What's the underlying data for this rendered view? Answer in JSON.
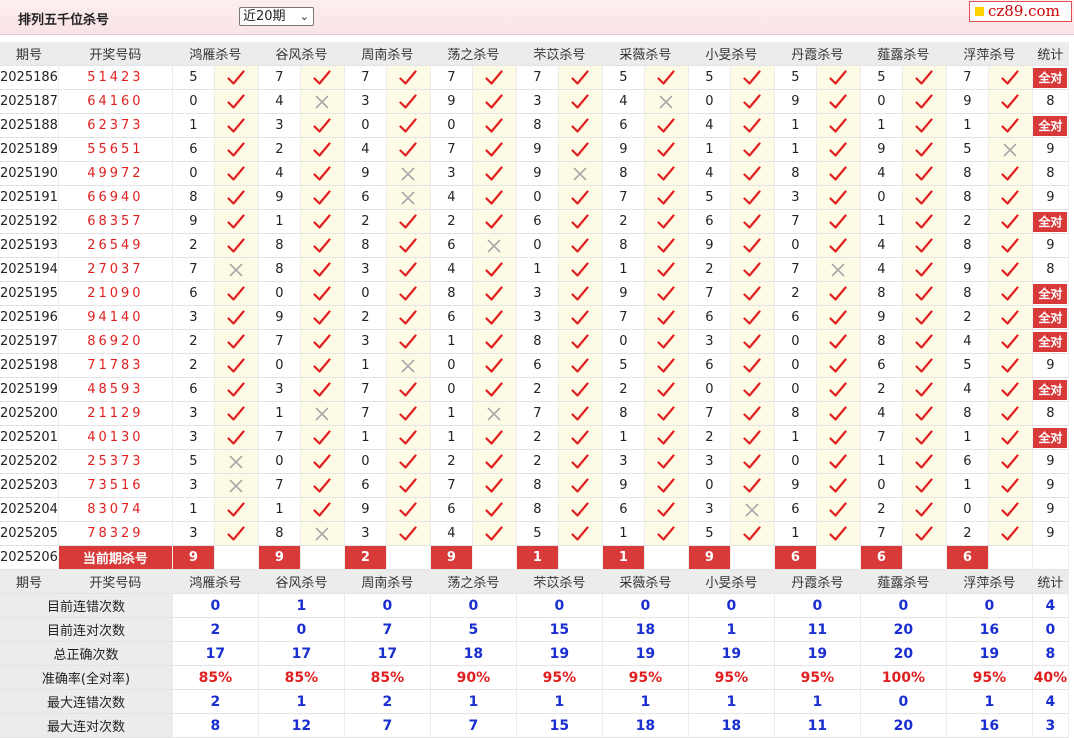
{
  "header": {
    "title": "排列五千位杀号",
    "period_select": "近20期"
  },
  "logo": {
    "text": "cz89.com"
  },
  "columns": {
    "issue": "期号",
    "draw": "开奖号码",
    "experts": [
      "鸿雁杀号",
      "谷风杀号",
      "周南杀号",
      "荡之杀号",
      "芣苡杀号",
      "采薇杀号",
      "小旻杀号",
      "丹霞杀号",
      "薤露杀号",
      "浮萍杀号"
    ],
    "total": "统计"
  },
  "all_correct_label": "全对",
  "rows": [
    {
      "issue": "2025186",
      "draw": "51423",
      "nums": [
        5,
        7,
        7,
        7,
        7,
        5,
        5,
        5,
        5,
        7
      ],
      "res": [
        1,
        1,
        1,
        1,
        1,
        1,
        1,
        1,
        1,
        1
      ],
      "total": "全对"
    },
    {
      "issue": "2025187",
      "draw": "64160",
      "nums": [
        0,
        4,
        3,
        9,
        3,
        4,
        0,
        9,
        0,
        9
      ],
      "res": [
        1,
        0,
        1,
        1,
        1,
        0,
        1,
        1,
        1,
        1
      ],
      "total": "8"
    },
    {
      "issue": "2025188",
      "draw": "62373",
      "nums": [
        1,
        3,
        0,
        0,
        8,
        6,
        4,
        1,
        1,
        1
      ],
      "res": [
        1,
        1,
        1,
        1,
        1,
        1,
        1,
        1,
        1,
        1
      ],
      "total": "全对"
    },
    {
      "issue": "2025189",
      "draw": "55651",
      "nums": [
        6,
        2,
        4,
        7,
        9,
        9,
        1,
        1,
        9,
        5
      ],
      "res": [
        1,
        1,
        1,
        1,
        1,
        1,
        1,
        1,
        1,
        0
      ],
      "total": "9"
    },
    {
      "issue": "2025190",
      "draw": "49972",
      "nums": [
        0,
        4,
        9,
        3,
        9,
        8,
        4,
        8,
        4,
        8
      ],
      "res": [
        1,
        1,
        0,
        1,
        0,
        1,
        1,
        1,
        1,
        1
      ],
      "total": "8"
    },
    {
      "issue": "2025191",
      "draw": "66940",
      "nums": [
        8,
        9,
        6,
        4,
        0,
        7,
        5,
        3,
        0,
        8
      ],
      "res": [
        1,
        1,
        0,
        1,
        1,
        1,
        1,
        1,
        1,
        1
      ],
      "total": "9"
    },
    {
      "issue": "2025192",
      "draw": "68357",
      "nums": [
        9,
        1,
        2,
        2,
        6,
        2,
        6,
        7,
        1,
        2
      ],
      "res": [
        1,
        1,
        1,
        1,
        1,
        1,
        1,
        1,
        1,
        1
      ],
      "total": "全对"
    },
    {
      "issue": "2025193",
      "draw": "26549",
      "nums": [
        2,
        8,
        8,
        6,
        0,
        8,
        9,
        0,
        4,
        8
      ],
      "res": [
        1,
        1,
        1,
        0,
        1,
        1,
        1,
        1,
        1,
        1
      ],
      "total": "9"
    },
    {
      "issue": "2025194",
      "draw": "27037",
      "nums": [
        7,
        8,
        3,
        4,
        1,
        1,
        2,
        7,
        4,
        9
      ],
      "res": [
        0,
        1,
        1,
        1,
        1,
        1,
        1,
        0,
        1,
        1
      ],
      "total": "8"
    },
    {
      "issue": "2025195",
      "draw": "21090",
      "nums": [
        6,
        0,
        0,
        8,
        3,
        9,
        7,
        2,
        8,
        8
      ],
      "res": [
        1,
        1,
        1,
        1,
        1,
        1,
        1,
        1,
        1,
        1
      ],
      "total": "全对"
    },
    {
      "issue": "2025196",
      "draw": "94140",
      "nums": [
        3,
        9,
        2,
        6,
        3,
        7,
        6,
        6,
        9,
        2
      ],
      "res": [
        1,
        1,
        1,
        1,
        1,
        1,
        1,
        1,
        1,
        1
      ],
      "total": "全对"
    },
    {
      "issue": "2025197",
      "draw": "86920",
      "nums": [
        2,
        7,
        3,
        1,
        8,
        0,
        3,
        0,
        8,
        4
      ],
      "res": [
        1,
        1,
        1,
        1,
        1,
        1,
        1,
        1,
        1,
        1
      ],
      "total": "全对"
    },
    {
      "issue": "2025198",
      "draw": "71783",
      "nums": [
        2,
        0,
        1,
        0,
        6,
        5,
        6,
        0,
        6,
        5
      ],
      "res": [
        1,
        1,
        0,
        1,
        1,
        1,
        1,
        1,
        1,
        1
      ],
      "total": "9"
    },
    {
      "issue": "2025199",
      "draw": "48593",
      "nums": [
        6,
        3,
        7,
        0,
        2,
        2,
        0,
        0,
        2,
        4
      ],
      "res": [
        1,
        1,
        1,
        1,
        1,
        1,
        1,
        1,
        1,
        1
      ],
      "total": "全对"
    },
    {
      "issue": "2025200",
      "draw": "21129",
      "nums": [
        3,
        1,
        7,
        1,
        7,
        8,
        7,
        8,
        4,
        8
      ],
      "res": [
        1,
        0,
        1,
        0,
        1,
        1,
        1,
        1,
        1,
        1
      ],
      "total": "8"
    },
    {
      "issue": "2025201",
      "draw": "40130",
      "nums": [
        3,
        7,
        1,
        1,
        2,
        1,
        2,
        1,
        7,
        1
      ],
      "res": [
        1,
        1,
        1,
        1,
        1,
        1,
        1,
        1,
        1,
        1
      ],
      "total": "全对"
    },
    {
      "issue": "2025202",
      "draw": "25373",
      "nums": [
        5,
        0,
        0,
        2,
        2,
        3,
        3,
        0,
        1,
        6
      ],
      "res": [
        0,
        1,
        1,
        1,
        1,
        1,
        1,
        1,
        1,
        1
      ],
      "total": "9"
    },
    {
      "issue": "2025203",
      "draw": "73516",
      "nums": [
        3,
        7,
        6,
        7,
        8,
        9,
        0,
        9,
        0,
        1
      ],
      "res": [
        0,
        1,
        1,
        1,
        1,
        1,
        1,
        1,
        1,
        1
      ],
      "total": "9"
    },
    {
      "issue": "2025204",
      "draw": "83074",
      "nums": [
        1,
        1,
        9,
        6,
        8,
        6,
        3,
        6,
        2,
        0
      ],
      "res": [
        1,
        1,
        1,
        1,
        1,
        1,
        0,
        1,
        1,
        1
      ],
      "total": "9"
    },
    {
      "issue": "2025205",
      "draw": "78329",
      "nums": [
        3,
        8,
        3,
        4,
        5,
        1,
        5,
        1,
        7,
        2
      ],
      "res": [
        1,
        0,
        1,
        1,
        1,
        1,
        1,
        1,
        1,
        1
      ],
      "total": "9"
    }
  ],
  "current": {
    "issue": "2025206",
    "label": "当前期杀号",
    "nums": [
      9,
      9,
      2,
      9,
      1,
      1,
      9,
      6,
      6,
      6
    ]
  },
  "stats": [
    {
      "label": "目前连错次数",
      "values": [
        "0",
        "1",
        "0",
        "0",
        "0",
        "0",
        "0",
        "0",
        "0",
        "0"
      ],
      "total": "4",
      "kind": "count"
    },
    {
      "label": "目前连对次数",
      "values": [
        "2",
        "0",
        "7",
        "5",
        "15",
        "18",
        "1",
        "11",
        "20",
        "16"
      ],
      "total": "0",
      "kind": "count"
    },
    {
      "label": "总正确次数",
      "values": [
        "17",
        "17",
        "17",
        "18",
        "19",
        "19",
        "19",
        "19",
        "20",
        "19"
      ],
      "total": "8",
      "kind": "count"
    },
    {
      "label": "准确率(全对率)",
      "values": [
        "85%",
        "85%",
        "85%",
        "90%",
        "95%",
        "95%",
        "95%",
        "95%",
        "100%",
        "95%"
      ],
      "total": "40%",
      "kind": "rate"
    },
    {
      "label": "最大连错次数",
      "values": [
        "2",
        "1",
        "2",
        "1",
        "1",
        "1",
        "1",
        "1",
        "0",
        "1"
      ],
      "total": "4",
      "kind": "count"
    },
    {
      "label": "最大连对次数",
      "values": [
        "8",
        "12",
        "7",
        "7",
        "15",
        "18",
        "18",
        "11",
        "20",
        "16"
      ],
      "total": "3",
      "kind": "count"
    }
  ],
  "colors": {
    "accent_red": "#d83a3a",
    "check_red": "#e02020",
    "cross_gray": "#a9a9a9",
    "stat_blue": "#1a2fd0",
    "header_pink": "#fdeef0"
  },
  "icons": {
    "correct": "check-icon",
    "wrong": "cross-icon"
  }
}
